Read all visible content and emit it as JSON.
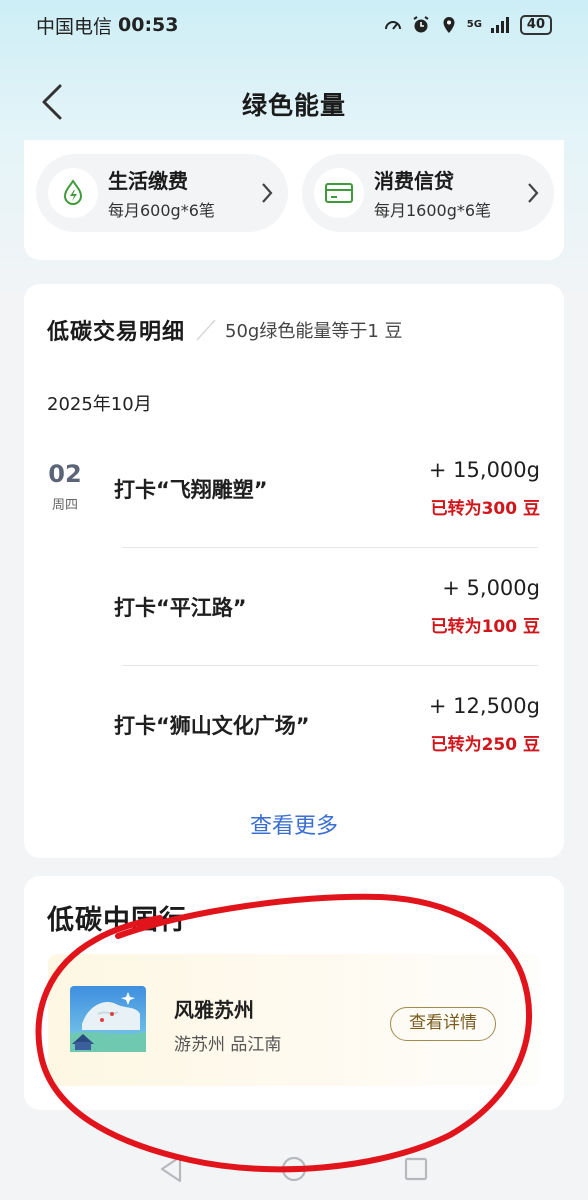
{
  "status_bar": {
    "carrier": "中国电信",
    "time": "00:53",
    "network": "5G",
    "battery": "40"
  },
  "header": {
    "title": "绿色能量",
    "back_icon": "chevron-left-icon"
  },
  "services": [
    {
      "title": "生活缴费",
      "subtitle": "每月600g*6笔",
      "icon": "energy-drop-icon"
    },
    {
      "title": "消费信贷",
      "subtitle": "每月1600g*6笔",
      "icon": "card-icon"
    }
  ],
  "transactions": {
    "title": "低碳交易明细",
    "note": "50g绿色能量等于1 豆",
    "month": "2025年10月",
    "date_day": "02",
    "date_weekday": "周四",
    "items": [
      {
        "name": "打卡“飞翔雕塑”",
        "amount": "+ 15,000g",
        "converted": "已转为300 豆"
      },
      {
        "name": "打卡“平江路”",
        "amount": "+ 5,000g",
        "converted": "已转为100 豆"
      },
      {
        "name": "打卡“狮山文化广场”",
        "amount": "+ 12,500g",
        "converted": "已转为250 豆"
      }
    ],
    "see_more": "查看更多"
  },
  "trip": {
    "title": "低碳中国行",
    "item": {
      "name": "风雅苏州",
      "subtitle": "游苏州 品江南",
      "button": "查看详情"
    }
  },
  "colors": {
    "accent_blue": "#3b6fd0",
    "converted_red": "#d0161b",
    "annotation_red": "#e0141a",
    "service_icon_green": "#3f9b3a"
  }
}
